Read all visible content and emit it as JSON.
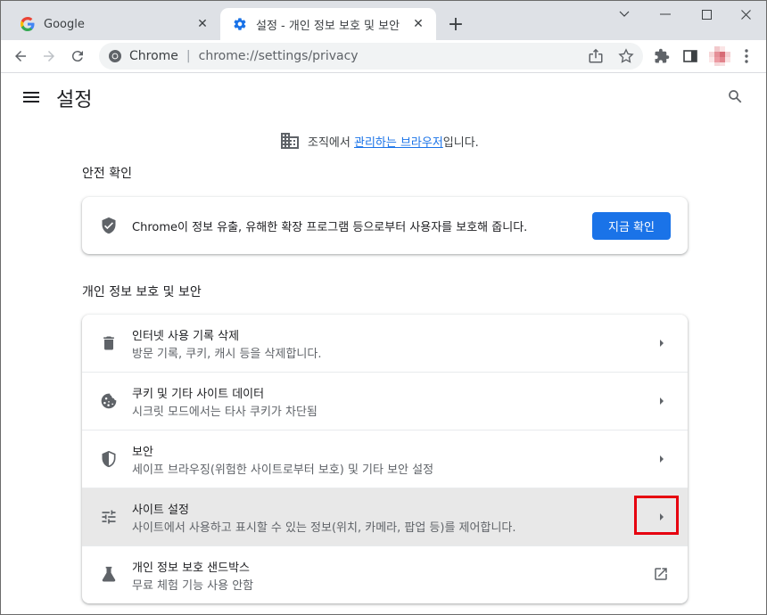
{
  "browser": {
    "tabs": [
      {
        "title": "Google",
        "favicon": "google-g-icon"
      },
      {
        "title": "설정 - 개인 정보 보호 및 보안",
        "favicon": "gear-icon"
      }
    ],
    "new_tab": "+",
    "omnibox": {
      "site_label": "Chrome",
      "url": "chrome://settings/privacy"
    }
  },
  "settings": {
    "title": "설정",
    "managed_prefix": "조직에서 ",
    "managed_link": "관리하는 브라우저",
    "managed_suffix": "입니다.",
    "safety_check": {
      "section_title": "안전 확인",
      "description": "Chrome이 정보 유출, 유해한 확장 프로그램 등으로부터 사용자를 보호해 줍니다.",
      "button": "지금 확인"
    },
    "privacy": {
      "section_title": "개인 정보 보호 및 보안",
      "items": [
        {
          "title": "인터넷 사용 기록 삭제",
          "subtitle": "방문 기록, 쿠키, 캐시 등을 삭제합니다.",
          "icon": "trash-icon"
        },
        {
          "title": "쿠키 및 기타 사이트 데이터",
          "subtitle": "시크릿 모드에서는 타사 쿠키가 차단됨",
          "icon": "cookie-icon"
        },
        {
          "title": "보안",
          "subtitle": "세이프 브라우징(위험한 사이트로부터 보호) 및 기타 보안 설정",
          "icon": "shield-icon"
        },
        {
          "title": "사이트 설정",
          "subtitle": "사이트에서 사용하고 표시할 수 있는 정보(위치, 카메라, 팝업 등)를 제어합니다.",
          "icon": "tune-icon"
        },
        {
          "title": "개인 정보 보호 샌드박스",
          "subtitle": "무료 체험 기능 사용 안함",
          "icon": "flask-icon"
        }
      ]
    }
  },
  "colors": {
    "accent": "#1a73e8",
    "highlight_box": "#e6000f",
    "row_highlight": "#e8e8e8"
  }
}
